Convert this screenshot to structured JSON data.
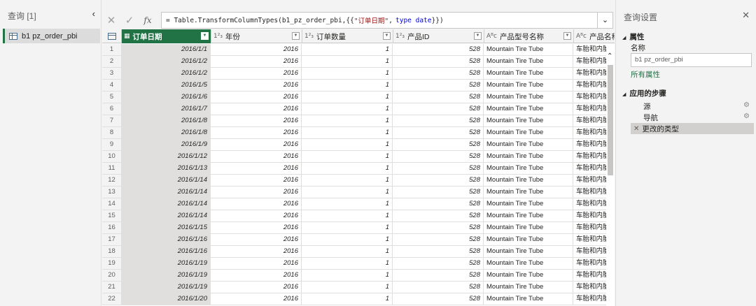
{
  "queries_pane": {
    "title": "查询 [1]",
    "collapse_glyph": "‹",
    "items": [
      {
        "label": "b1 pz_order_pbi"
      }
    ]
  },
  "formula_bar": {
    "cancel_glyph": "✕",
    "confirm_glyph": "✓",
    "fx_label": "fx",
    "prefix": "= Table.TransformColumnTypes(b1_pz_order_pbi,{{",
    "string": "\"订单日期\"",
    "middle": ",",
    "keyword": "type date",
    "suffix": "}})",
    "expand_glyph": "⌄"
  },
  "columns": [
    {
      "name": "订单日期",
      "type_icon": "▦",
      "selected": true
    },
    {
      "name": "年份",
      "type_icon": "1²₃"
    },
    {
      "name": "订单数量",
      "type_icon": "1²₃"
    },
    {
      "name": "产品ID",
      "type_icon": "1²₃"
    },
    {
      "name": "产品型号名称",
      "type_icon": "Aᴮc"
    },
    {
      "name": "产品名称",
      "type_icon": "Aᴮc"
    }
  ],
  "rows": [
    [
      "1",
      "2016/1/1",
      "2016",
      "1",
      "528",
      "Mountain Tire Tube",
      "车胎和内胎"
    ],
    [
      "2",
      "2016/1/2",
      "2016",
      "1",
      "528",
      "Mountain Tire Tube",
      "车胎和内胎"
    ],
    [
      "3",
      "2016/1/2",
      "2016",
      "1",
      "528",
      "Mountain Tire Tube",
      "车胎和内胎"
    ],
    [
      "4",
      "2016/1/5",
      "2016",
      "1",
      "528",
      "Mountain Tire Tube",
      "车胎和内胎"
    ],
    [
      "5",
      "2016/1/6",
      "2016",
      "1",
      "528",
      "Mountain Tire Tube",
      "车胎和内胎"
    ],
    [
      "6",
      "2016/1/7",
      "2016",
      "1",
      "528",
      "Mountain Tire Tube",
      "车胎和内胎"
    ],
    [
      "7",
      "2016/1/8",
      "2016",
      "1",
      "528",
      "Mountain Tire Tube",
      "车胎和内胎"
    ],
    [
      "8",
      "2016/1/8",
      "2016",
      "1",
      "528",
      "Mountain Tire Tube",
      "车胎和内胎"
    ],
    [
      "9",
      "2016/1/9",
      "2016",
      "1",
      "528",
      "Mountain Tire Tube",
      "车胎和内胎"
    ],
    [
      "10",
      "2016/1/12",
      "2016",
      "1",
      "528",
      "Mountain Tire Tube",
      "车胎和内胎"
    ],
    [
      "11",
      "2016/1/13",
      "2016",
      "1",
      "528",
      "Mountain Tire Tube",
      "车胎和内胎"
    ],
    [
      "12",
      "2016/1/14",
      "2016",
      "1",
      "528",
      "Mountain Tire Tube",
      "车胎和内胎"
    ],
    [
      "13",
      "2016/1/14",
      "2016",
      "1",
      "528",
      "Mountain Tire Tube",
      "车胎和内胎"
    ],
    [
      "14",
      "2016/1/14",
      "2016",
      "1",
      "528",
      "Mountain Tire Tube",
      "车胎和内胎"
    ],
    [
      "15",
      "2016/1/14",
      "2016",
      "1",
      "528",
      "Mountain Tire Tube",
      "车胎和内胎"
    ],
    [
      "16",
      "2016/1/15",
      "2016",
      "1",
      "528",
      "Mountain Tire Tube",
      "车胎和内胎"
    ],
    [
      "17",
      "2016/1/16",
      "2016",
      "1",
      "528",
      "Mountain Tire Tube",
      "车胎和内胎"
    ],
    [
      "18",
      "2016/1/16",
      "2016",
      "1",
      "528",
      "Mountain Tire Tube",
      "车胎和内胎"
    ],
    [
      "19",
      "2016/1/19",
      "2016",
      "1",
      "528",
      "Mountain Tire Tube",
      "车胎和内胎"
    ],
    [
      "20",
      "2016/1/19",
      "2016",
      "1",
      "528",
      "Mountain Tire Tube",
      "车胎和内胎"
    ],
    [
      "21",
      "2016/1/19",
      "2016",
      "1",
      "528",
      "Mountain Tire Tube",
      "车胎和内胎"
    ],
    [
      "22",
      "2016/1/20",
      "2016",
      "1",
      "528",
      "Mountain Tire Tube",
      "车胎和内胎"
    ]
  ],
  "settings_pane": {
    "title": "查询设置",
    "close_glyph": "✕",
    "properties_heading": "属性",
    "name_label": "名称",
    "name_value": "b1 pz_order_pbi",
    "all_properties_link": "所有属性",
    "steps_heading": "应用的步骤",
    "steps": [
      {
        "label": "源",
        "has_gear": true
      },
      {
        "label": "导航",
        "has_gear": true
      },
      {
        "label": "更改的类型",
        "active": true
      }
    ]
  },
  "colors": {
    "accent": "#217346",
    "selected_column_bg": "#e1dfdd"
  }
}
